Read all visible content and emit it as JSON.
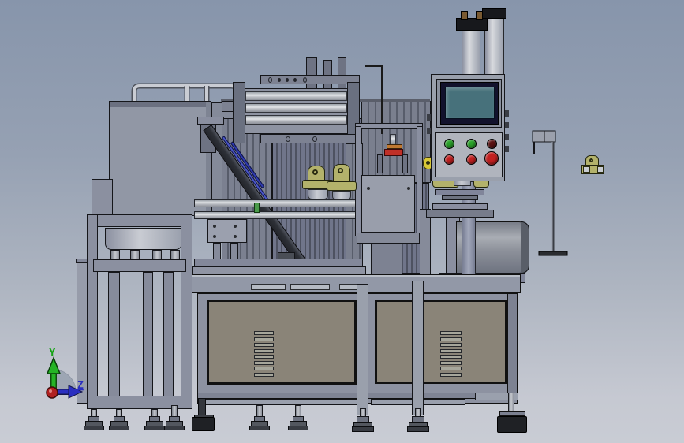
{
  "viewport": {
    "description": "CAD side view of automated assembly machine"
  },
  "triad": {
    "y_label": "Y",
    "z_label": "Z",
    "y_color": "#15a315",
    "z_color": "#2a2ec0",
    "origin_color": "#b02020",
    "arc_color": "#9aa3b2"
  },
  "colors": {
    "khaki": "#b3b26b",
    "red_part": "#c03028",
    "orange_strip": "#c07830",
    "conveyor_accent": "#4a55c8",
    "conveyor_accent_dark": "#2f3ab0",
    "yellow_follower": "#d8c838",
    "green_indicator": "#4a9a4a",
    "black_mount": "#1f2125"
  },
  "control_panel": {
    "screen_color": "#47717b",
    "screen_border": "#12122c",
    "buttons": [
      {
        "name": "button-green-1",
        "color": "#2aa32a"
      },
      {
        "name": "button-green-2",
        "color": "#2aa32a"
      },
      {
        "name": "button-dark-red",
        "color": "#5c1212"
      },
      {
        "name": "button-red-1",
        "color": "#c22020"
      },
      {
        "name": "button-red-2",
        "color": "#c22020"
      },
      {
        "name": "button-emergency-stop",
        "color": "#c22020"
      }
    ]
  }
}
